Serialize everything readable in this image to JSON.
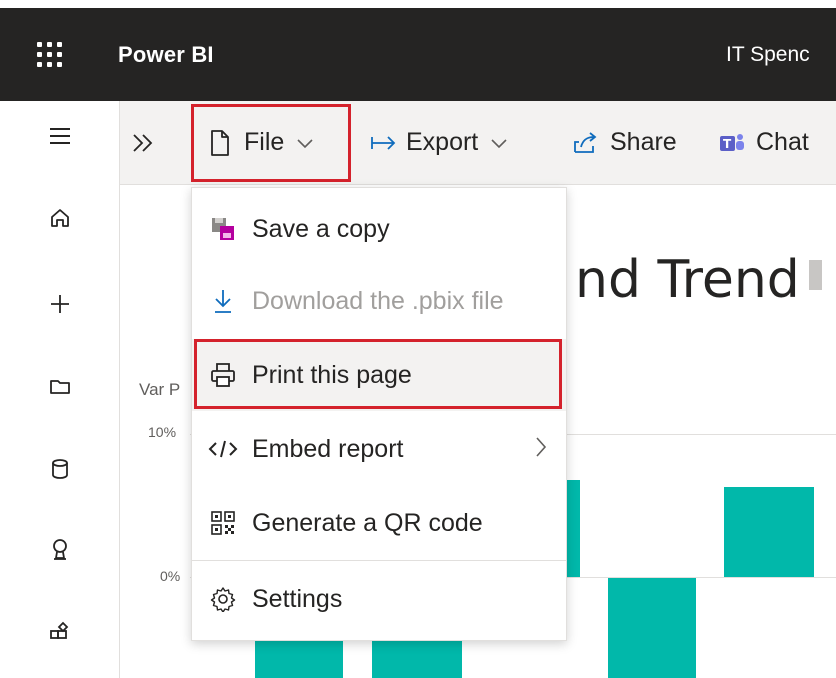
{
  "app": {
    "brand": "Power BI",
    "report_title": "IT Spenc"
  },
  "toolbar": {
    "file_label": "File",
    "export_label": "Export",
    "share_label": "Share",
    "chat_label": "Chat"
  },
  "file_menu": {
    "items": [
      {
        "label": "Save a copy",
        "icon": "save-copy-icon",
        "enabled": true
      },
      {
        "label": "Download the .pbix file",
        "icon": "download-icon",
        "enabled": false
      },
      {
        "label": "Print this page",
        "icon": "printer-icon",
        "enabled": true,
        "highlighted": true
      },
      {
        "label": "Embed report",
        "icon": "code-icon",
        "enabled": true,
        "has_submenu": true
      },
      {
        "label": "Generate a QR code",
        "icon": "qr-code-icon",
        "enabled": true
      },
      {
        "label": "Settings",
        "icon": "gear-icon",
        "enabled": true
      }
    ]
  },
  "report": {
    "visual_title_fragment": "nd Trend",
    "y_axis_label": "Var P",
    "ticks": [
      "10%",
      "0%"
    ]
  },
  "left_nav": {
    "icons": [
      "home-icon",
      "create-icon",
      "browse-icon",
      "datahub-icon",
      "goals-icon",
      "apps-icon"
    ]
  },
  "colors": {
    "topbar": "#252423",
    "accent_highlight": "#d4222c",
    "bar": "#01b8aa"
  }
}
